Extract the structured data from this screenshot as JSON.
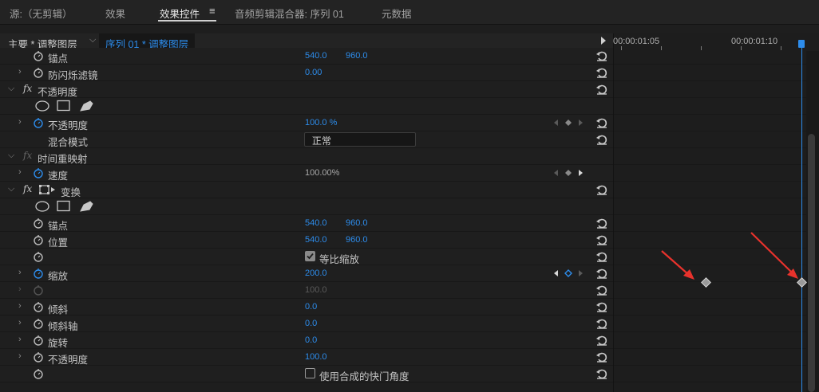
{
  "tabs": [
    "源:（无剪辑）",
    "效果",
    "效果控件",
    "音频剪辑混合器: 序列 01",
    "元数据"
  ],
  "tab_menu_icon": "hamburger-menu-icon",
  "sequence": {
    "master": "主要 * 调整图层",
    "clip": "序列 01 * 调整图层"
  },
  "timeline": {
    "tc1": "00:00:01:05",
    "tc2": "00:00:01:10"
  },
  "rows": {
    "anchor1": {
      "label": "锚点",
      "x": "540.0",
      "y": "960.0"
    },
    "antiflicker": {
      "label": "防闪烁滤镜",
      "value": "0.00"
    },
    "opacity_fx": {
      "label": "不透明度",
      "fx": "fx"
    },
    "opacity": {
      "label": "不透明度",
      "value": "100.0 %"
    },
    "blend": {
      "label": "混合模式",
      "value": "正常"
    },
    "timeremap_fx": {
      "label": "时间重映射",
      "fx": "fx"
    },
    "speed": {
      "label": "速度",
      "value": "100.00%"
    },
    "transform_fx": {
      "label": "变换",
      "fx": "fx"
    },
    "anchor2": {
      "label": "锚点",
      "x": "540.0",
      "y": "960.0"
    },
    "position": {
      "label": "位置",
      "x": "540.0",
      "y": "960.0"
    },
    "uniform": {
      "label": "等比缩放"
    },
    "scale": {
      "label": "缩放",
      "value": "200.0"
    },
    "scalewidth": {
      "value": "100.0"
    },
    "skew": {
      "label": "倾斜",
      "value": "0.0"
    },
    "skewaxis": {
      "label": "倾斜轴",
      "value": "0.0"
    },
    "rotation": {
      "label": "旋转",
      "value": "0.0"
    },
    "opacity2": {
      "label": "不透明度",
      "value": "100.0"
    },
    "shutter": {
      "label": "使用合成的快门角度"
    }
  },
  "colors": {
    "accent": "#2d8ceb",
    "annotation": "#e8322c"
  }
}
